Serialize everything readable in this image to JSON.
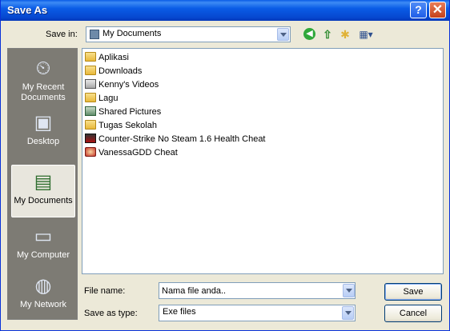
{
  "window": {
    "title": "Save As",
    "help_glyph": "?",
    "close_glyph": "✕"
  },
  "toolbar": {
    "save_in_label": "Save in:",
    "save_in_value": "My Documents",
    "back_glyph": "◀",
    "up_glyph": "⇧",
    "new_folder_glyph": "✱",
    "views_glyph": "▦▾"
  },
  "places": [
    {
      "label": "My Recent Documents",
      "icon": "recent-documents-icon",
      "glyph": "⏲"
    },
    {
      "label": "Desktop",
      "icon": "desktop-icon",
      "glyph": "▣"
    },
    {
      "label": "My Documents",
      "icon": "my-documents-icon",
      "glyph": "▤"
    },
    {
      "label": "My Computer",
      "icon": "my-computer-icon",
      "glyph": "▭"
    },
    {
      "label": "My Network",
      "icon": "my-network-icon",
      "glyph": "◍"
    }
  ],
  "files": [
    {
      "name": "Aplikasi",
      "icon": "folder-icon"
    },
    {
      "name": "Downloads",
      "icon": "folder-icon"
    },
    {
      "name": "Kenny's Videos",
      "icon": "video-folder-icon"
    },
    {
      "name": "Lagu",
      "icon": "folder-icon"
    },
    {
      "name": "Shared Pictures",
      "icon": "pictures-folder-icon"
    },
    {
      "name": "Tugas Sekolah",
      "icon": "folder-icon"
    },
    {
      "name": "Counter-Strike No Steam 1.6 Health Cheat",
      "icon": "exe-icon"
    },
    {
      "name": "VanessaGDD Cheat",
      "icon": "exe-icon"
    }
  ],
  "footer": {
    "file_name_label": "File name:",
    "file_name_value": "Nama file anda..",
    "save_as_type_label": "Save as type:",
    "save_as_type_value": "Exe files",
    "save_label": "Save",
    "cancel_label": "Cancel"
  }
}
